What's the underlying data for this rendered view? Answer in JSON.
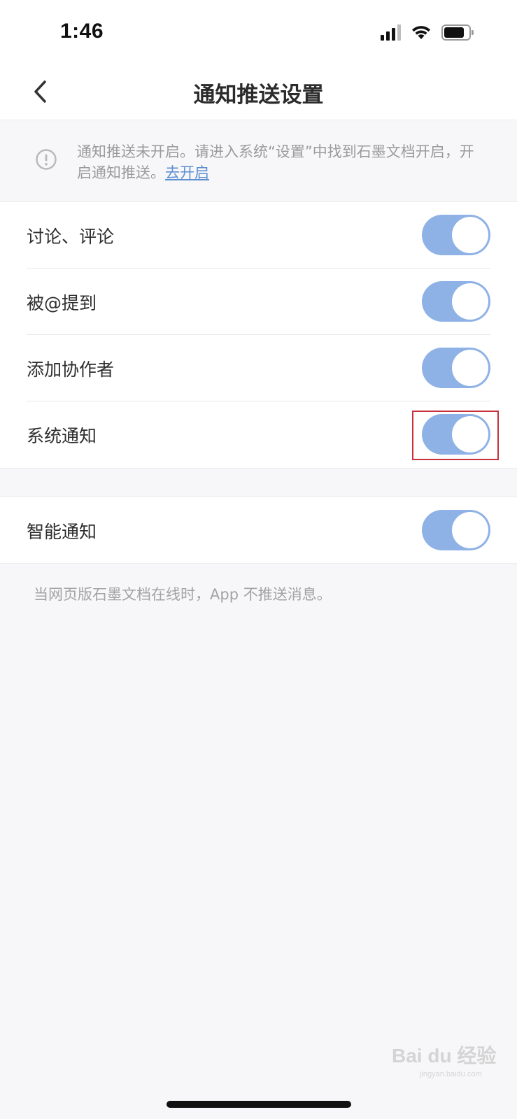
{
  "status_bar": {
    "time": "1:46",
    "icons": [
      "signal-icon",
      "wifi-icon",
      "battery-icon"
    ]
  },
  "nav": {
    "back_icon": "chevron-left-icon",
    "title": "通知推送设置"
  },
  "warning": {
    "icon": "info-circle-icon",
    "text": "通知推送未开启。请进入系统“设置”中找到石墨文档开启，开启通知推送。",
    "link": "去开启"
  },
  "settings": {
    "items": [
      {
        "label": "讨论、评论",
        "enabled": true
      },
      {
        "label": "被@提到",
        "enabled": true
      },
      {
        "label": "添加协作者",
        "enabled": true
      },
      {
        "label": "系统通知",
        "enabled": true
      }
    ],
    "smart": {
      "label": "智能通知",
      "enabled": true
    }
  },
  "footer_note": "当网页版石墨文档在线时，App 不推送消息。",
  "watermark": {
    "text": "Bai du 经验",
    "sub": "jingyan.baidu.com"
  },
  "colors": {
    "toggle_on": "#8fb2e6",
    "link": "#5b8fcf",
    "highlight": "#c8313b"
  }
}
